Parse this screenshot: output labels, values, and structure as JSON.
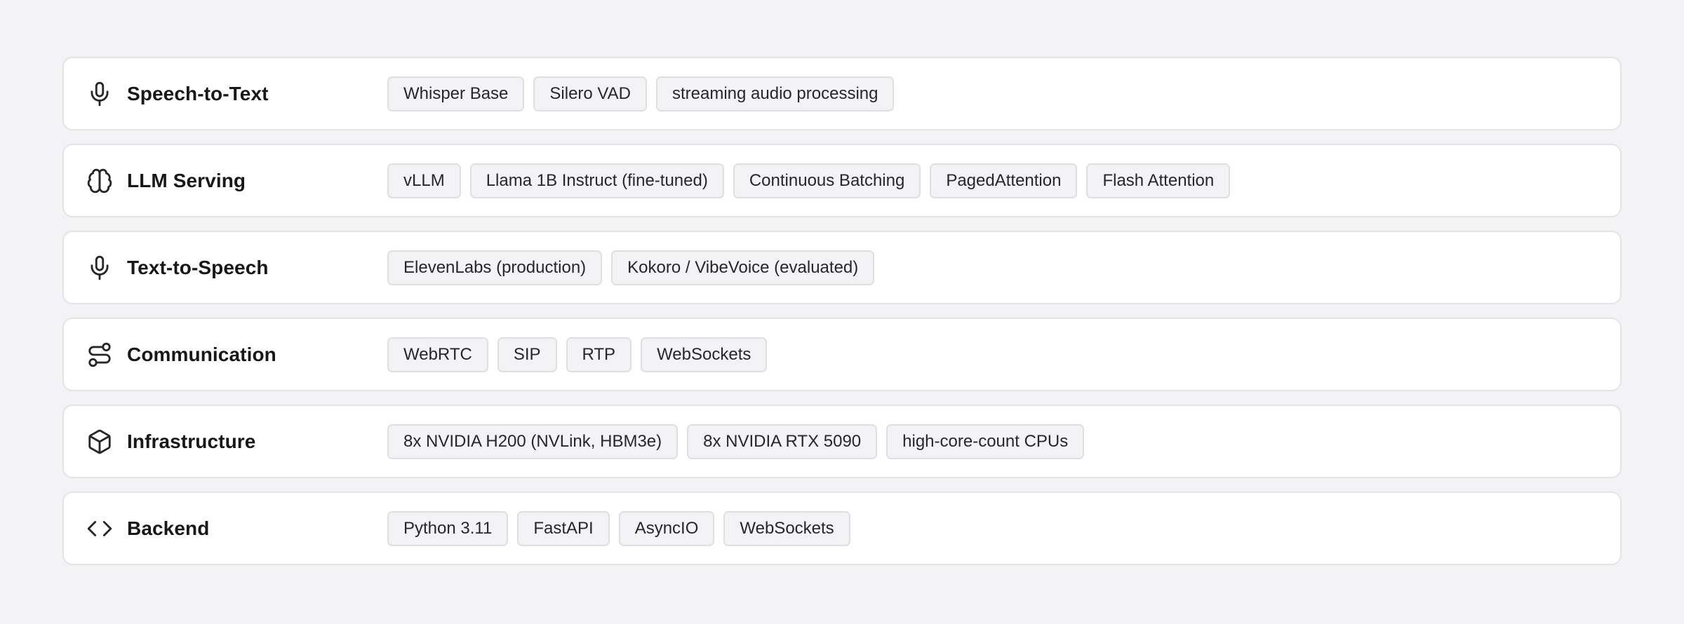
{
  "rows": [
    {
      "icon": "microphone-icon",
      "title": "Speech-to-Text",
      "tags": [
        "Whisper Base",
        "Silero VAD",
        "streaming audio processing"
      ]
    },
    {
      "icon": "brain-icon",
      "title": "LLM Serving",
      "tags": [
        "vLLM",
        "Llama 1B Instruct (fine-tuned)",
        "Continuous Batching",
        "PagedAttention",
        "Flash Attention"
      ]
    },
    {
      "icon": "microphone-icon",
      "title": "Text-to-Speech",
      "tags": [
        "ElevenLabs (production)",
        "Kokoro / VibeVoice (evaluated)"
      ]
    },
    {
      "icon": "route-icon",
      "title": "Communication",
      "tags": [
        "WebRTC",
        "SIP",
        "RTP",
        "WebSockets"
      ]
    },
    {
      "icon": "box-icon",
      "title": "Infrastructure",
      "tags": [
        "8x NVIDIA H200 (NVLink, HBM3e)",
        "8x NVIDIA RTX 5090",
        "high-core-count CPUs"
      ]
    },
    {
      "icon": "code-icon",
      "title": "Backend",
      "tags": [
        "Python 3.11",
        "FastAPI",
        "AsyncIO",
        "WebSockets"
      ]
    }
  ]
}
